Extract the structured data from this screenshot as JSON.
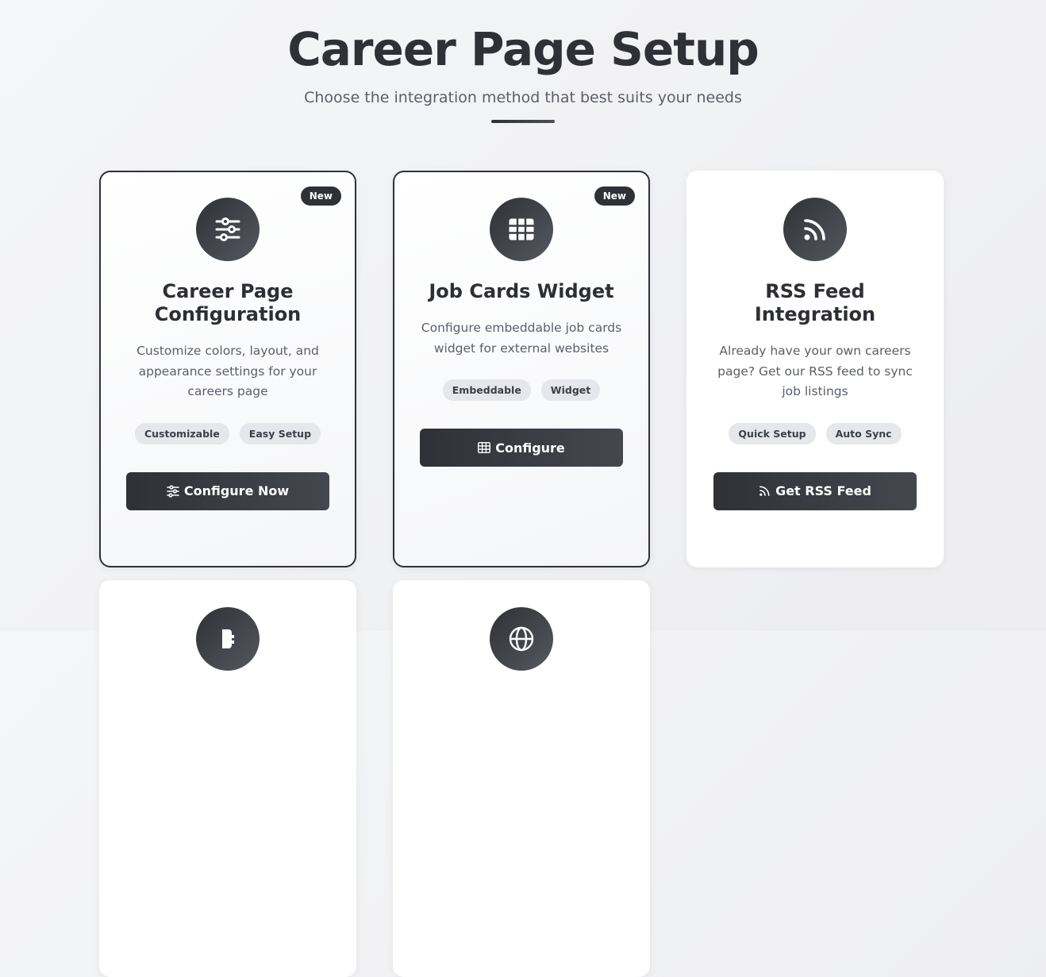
{
  "header": {
    "title": "Career Page Setup",
    "subtitle": "Choose the integration method that best suits your needs"
  },
  "cards": [
    {
      "badge": "New",
      "icon": "sliders-icon",
      "title_line1": "Career Page",
      "title_line2": "Configuration",
      "description": "Customize colors, layout, and appearance settings for your careers page",
      "tags": [
        "Customizable",
        "Easy Setup"
      ],
      "button_label": "Configure Now"
    },
    {
      "badge": "New",
      "icon": "grid-icon",
      "title": "Job Cards Widget",
      "description": "Configure embeddable job cards widget for external websites",
      "tags": [
        "Embeddable",
        "Widget"
      ],
      "button_label": "Configure"
    },
    {
      "icon": "rss-icon",
      "title_line1": "RSS Feed",
      "title_line2": "Integration",
      "description": "Already have your own careers page? Get our RSS feed to sync job listings",
      "tags": [
        "Quick Setup",
        "Auto Sync"
      ],
      "button_label": "Get RSS Feed"
    },
    {
      "icon": "plugin-icon"
    },
    {
      "icon": "globe-icon"
    }
  ],
  "colors": {
    "accent": "#2f3136",
    "tag_bg": "#e6e7ea",
    "text_muted": "#5b5f66"
  }
}
